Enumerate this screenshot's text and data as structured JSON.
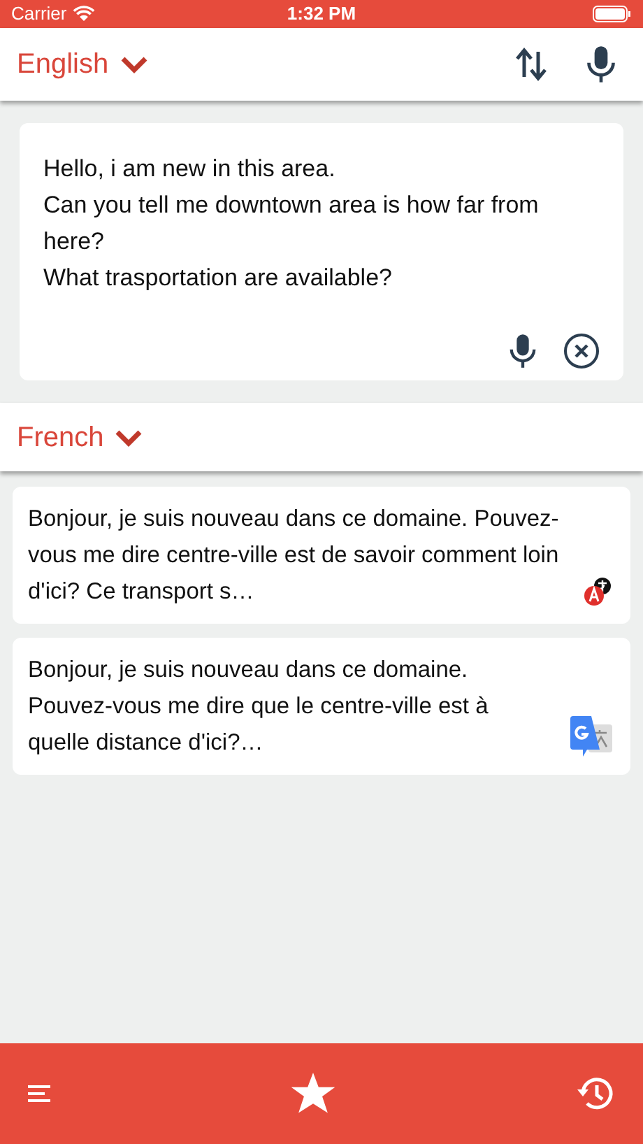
{
  "status_bar": {
    "carrier": "Carrier",
    "time": "1:32 PM"
  },
  "source": {
    "language": "English",
    "text": "Hello, i am new in this area.\nCan you tell me downtown area is how far from here?\nWhat trasportation are available?"
  },
  "target": {
    "language": "French"
  },
  "results": [
    {
      "kind": "dictionary",
      "text": "Bonjour, je suis nouveau dans ce domaine. Pouvez-vous me dire centre-ville est de savoir comment loin d'ici? Ce transport s…"
    },
    {
      "kind": "google",
      "text": "Bonjour, je suis nouveau dans ce domaine. Pouvez-vous me dire que le centre-ville est à quelle distance d'ici?…"
    }
  ]
}
